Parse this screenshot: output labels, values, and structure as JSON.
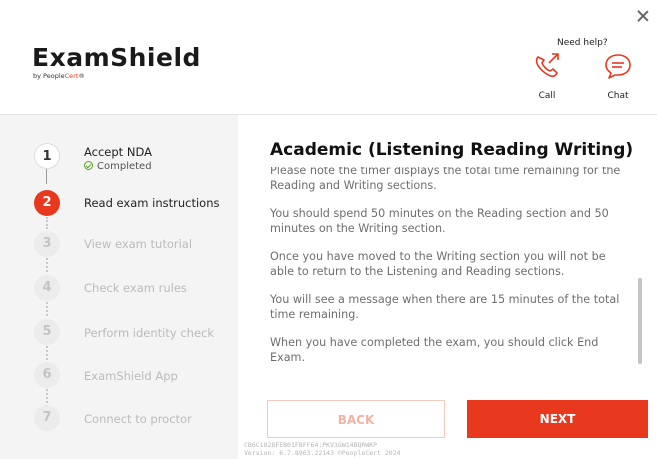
{
  "window": {
    "close_label": "×"
  },
  "brand": {
    "name": "ExamShield",
    "by": "by People",
    "by_accent": "Cert",
    "tm": "®"
  },
  "help": {
    "label": "Need help?",
    "call": "Call",
    "chat": "Chat"
  },
  "steps": [
    {
      "number": "1",
      "label": "Accept NDA",
      "status_text": "Completed",
      "state": "done"
    },
    {
      "number": "2",
      "label": "Read exam instructions",
      "state": "active"
    },
    {
      "number": "3",
      "label": "View exam tutorial",
      "state": "pending"
    },
    {
      "number": "4",
      "label": "Check exam rules",
      "state": "pending"
    },
    {
      "number": "5",
      "label": "Perform identity check",
      "state": "pending"
    },
    {
      "number": "6",
      "label": "ExamShield App",
      "state": "pending"
    },
    {
      "number": "7",
      "label": "Connect to proctor",
      "state": "pending"
    }
  ],
  "content": {
    "title": "Academic (Listening Reading Writing)",
    "paragraphs": [
      "Please note the timer displays the total time remaining for the Reading and Writing sections.",
      "You should spend 50 minutes on the Reading section and 50 minutes on the Writing section.",
      "Once you have moved to the Writing section you will not be able to return to the Listening and Reading sections.",
      "You will see a message when there are 15 minutes of the total time remaining.",
      "When you have completed the exam, you should click End Exam."
    ]
  },
  "buttons": {
    "back": "BACK",
    "next": "NEXT"
  },
  "footer": {
    "id": "CB6C1828FEB01FBFF64:PKV1GW14BQRWKP",
    "version": "Version: 6.7.8963.22143 ©PeopleCert 2024"
  },
  "colors": {
    "accent": "#e8391e",
    "completed": "#5aa02c"
  }
}
